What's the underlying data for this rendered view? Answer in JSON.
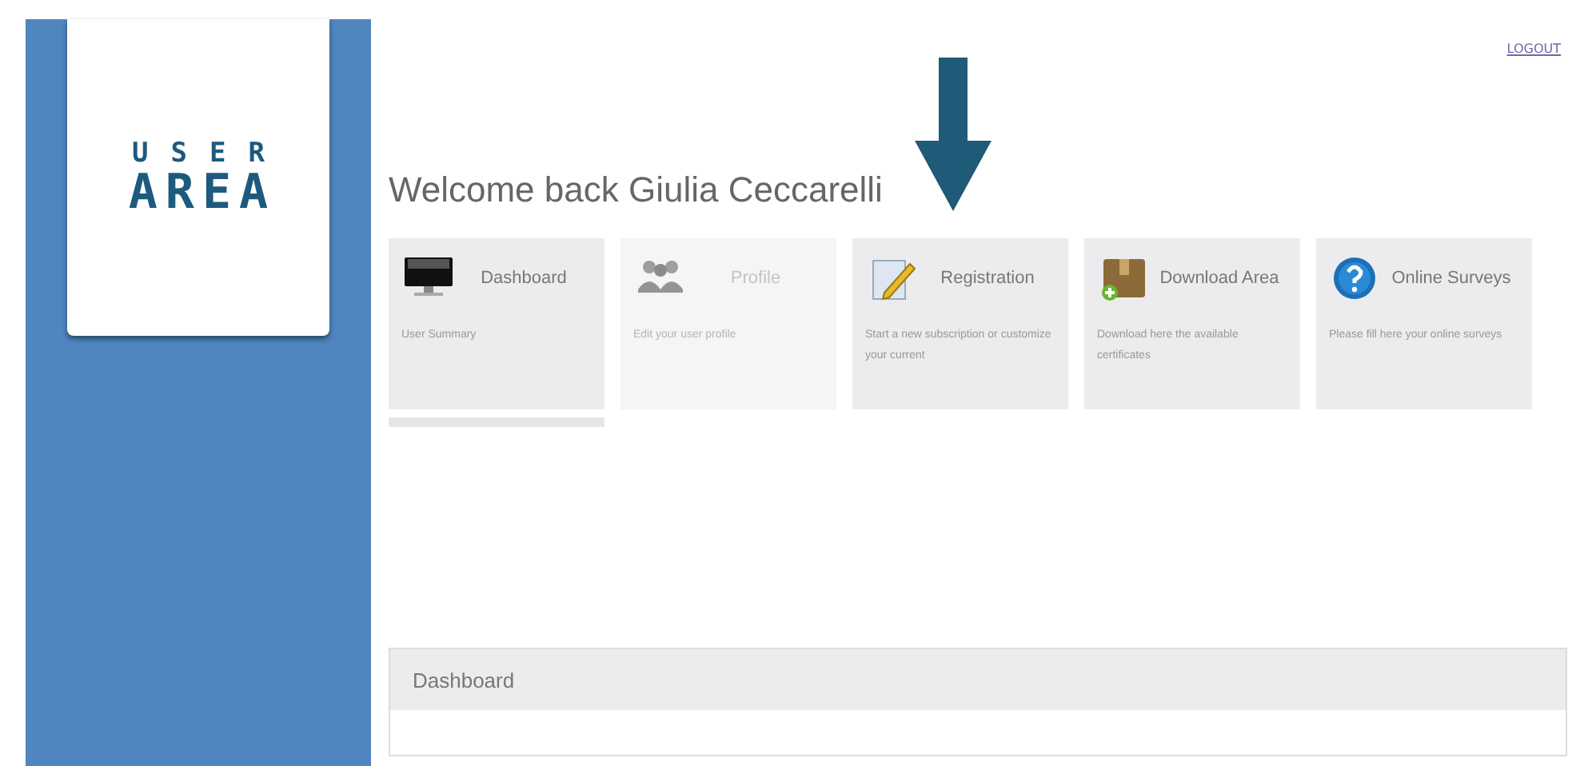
{
  "logo": {
    "line_1": "USER",
    "line_2": "AREA"
  },
  "logout": "LOGOUT",
  "title": "Welcome back Giulia Ceccarelli",
  "tiles": [
    {
      "kind": "monitor",
      "label": "Dashboard",
      "description": "User Summary",
      "disabled": false
    },
    {
      "kind": "people",
      "label": "Profile",
      "description": "Edit your user profile",
      "disabled": true
    },
    {
      "kind": "notepad",
      "label": "Registration",
      "description": "Start a new subscription or customize your current",
      "disabled": false
    },
    {
      "kind": "box",
      "label": "Download Area",
      "description": "Download here the available certificates",
      "disabled": false
    },
    {
      "kind": "help",
      "label": "Online Surveys",
      "description": "Please fill here your online surveys",
      "disabled": false
    }
  ],
  "panel": {
    "title": "Dashboard"
  }
}
